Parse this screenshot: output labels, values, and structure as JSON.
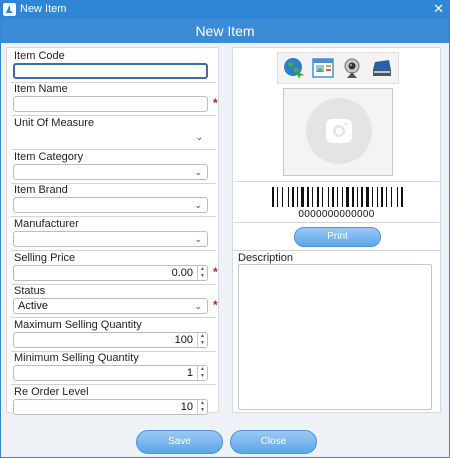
{
  "window": {
    "title": "New Item",
    "close_glyph": "✕"
  },
  "header": {
    "title": "New Item"
  },
  "form": {
    "item_code": {
      "label": "Item Code",
      "value": ""
    },
    "item_name": {
      "label": "Item Name",
      "value": "",
      "required_mark": "*"
    },
    "unit_of_measure": {
      "label": "Unit Of Measure",
      "value": ""
    },
    "item_category": {
      "label": "Item Category",
      "value": ""
    },
    "item_brand": {
      "label": "Item Brand",
      "value": ""
    },
    "manufacturer": {
      "label": "Manufacturer",
      "value": ""
    },
    "selling_price": {
      "label": "Selling Price",
      "value": "0.00",
      "required_mark": "*"
    },
    "status": {
      "label": "Status",
      "value": "Active",
      "required_mark": "*"
    },
    "max_selling_qty": {
      "label": "Maximum Selling Quantity",
      "value": "100"
    },
    "min_selling_qty": {
      "label": "Minimum Selling Quantity",
      "value": "1"
    },
    "reorder_level": {
      "label": "Re Order Level",
      "value": "10"
    }
  },
  "image_tools": [
    "web-image-icon",
    "gallery-image-icon",
    "webcam-icon",
    "scanner-icon"
  ],
  "barcode": {
    "number": "0000000000000",
    "print_label": "Print"
  },
  "description": {
    "label": "Description",
    "value": ""
  },
  "footer": {
    "save_label": "Save",
    "close_label": "Close"
  },
  "colors": {
    "titlebar": "#2f86d6",
    "header": "#3b8bd6",
    "button": "#5aa5ea",
    "required": "#d21b1b"
  }
}
